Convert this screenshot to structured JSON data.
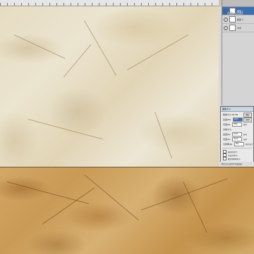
{
  "watermark": "hitu.com",
  "layers": [
    {
      "name": "图层 1",
      "selected": true
    },
    {
      "name": "图层 0",
      "selected": false
    },
    {
      "name": "背景",
      "selected": false
    }
  ],
  "dialog": {
    "title": "图像大小",
    "pixel_label": "像素大小:66.4M",
    "rows": [
      {
        "label": "宽度(W):",
        "value": "4000",
        "unit": "像素"
      },
      {
        "label": "高度(H):",
        "value": "5800",
        "unit": "像素"
      },
      {
        "label": "文档大小",
        "value": "",
        "unit": ""
      },
      {
        "label": "宽度(D):",
        "value": "33.87",
        "unit": "厘米"
      },
      {
        "label": "高度(G):",
        "value": "49.11",
        "unit": "厘米"
      },
      {
        "label": "分辨率(R):",
        "value": "300",
        "unit": "像素/英寸"
      }
    ],
    "checks": [
      "缩放样式(Y)",
      "约束比例(C)",
      "重定图像像素(I)"
    ],
    "buttons": [
      "确定",
      "取消"
    ],
    "status": "两次立方(适用于平滑渐变)"
  }
}
